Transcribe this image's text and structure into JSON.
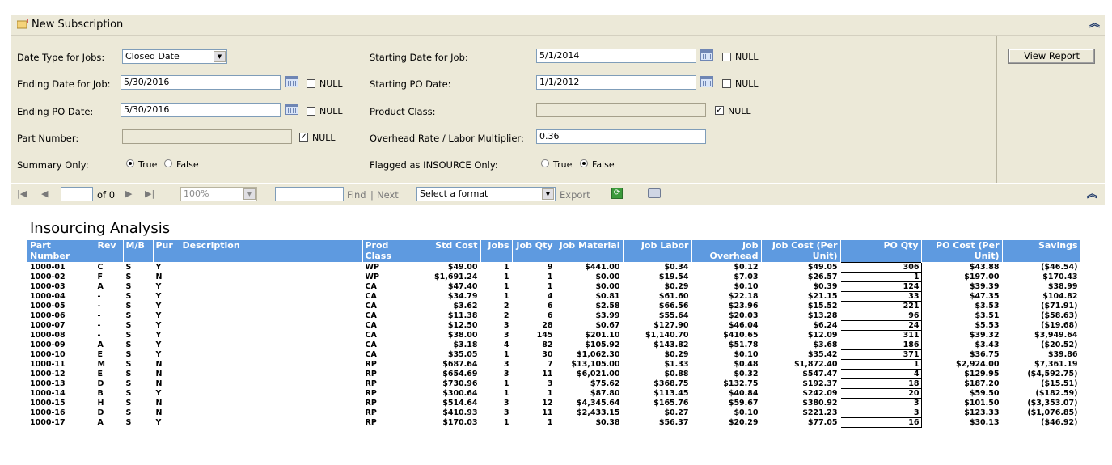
{
  "panel": {
    "title": "New Subscription"
  },
  "params": {
    "date_type_label": "Date Type for Jobs:",
    "date_type_value": "Closed Date",
    "starting_date_job_label": "Starting Date for Job:",
    "starting_date_job_value": "5/1/2014",
    "ending_date_job_label": "Ending Date for Job:",
    "ending_date_job_value": "5/30/2016",
    "starting_po_label": "Starting PO Date:",
    "starting_po_value": "1/1/2012",
    "ending_po_label": "Ending PO Date:",
    "ending_po_value": "5/30/2016",
    "product_class_label": "Product Class:",
    "product_class_value": "",
    "part_number_label": "Part Number:",
    "part_number_value": "",
    "overhead_label": "Overhead Rate / Labor Multiplier:",
    "overhead_value": "0.36",
    "summary_label": "Summary Only:",
    "insource_label": "Flagged as INSOURCE Only:",
    "null_label": "NULL",
    "true_label": "True",
    "false_label": "False",
    "view_report": "View Report"
  },
  "toolbar": {
    "page_value": "",
    "of_label": "of 0",
    "zoom": "100%",
    "find_value": "",
    "find_label": "Find",
    "sep": "|",
    "next_label": "Next",
    "format": "Select a format",
    "export_label": "Export"
  },
  "report": {
    "title": "Insourcing Analysis",
    "columns": [
      "Part Number",
      "Rev",
      "M/B",
      "Pur",
      "Description",
      "Prod Class",
      "Std Cost",
      "Jobs",
      "Job Qty",
      "Job Material",
      "Job Labor",
      "Job Overhead",
      "Job Cost (Per Unit)",
      "PO Qty",
      "PO Cost (Per Unit)",
      "Savings"
    ],
    "rows": [
      [
        "1000-01",
        "C",
        "S",
        "Y",
        "",
        "WP",
        "$49.00",
        "1",
        "9",
        "$441.00",
        "$0.34",
        "$0.12",
        "$49.05",
        "306",
        "$43.88",
        "($46.54)"
      ],
      [
        "1000-02",
        "F",
        "S",
        "N",
        "",
        "WP",
        "$1,691.24",
        "1",
        "1",
        "$0.00",
        "$19.54",
        "$7.03",
        "$26.57",
        "1",
        "$197.00",
        "$170.43"
      ],
      [
        "1000-03",
        "A",
        "S",
        "Y",
        "",
        "CA",
        "$47.40",
        "1",
        "1",
        "$0.00",
        "$0.29",
        "$0.10",
        "$0.39",
        "124",
        "$39.39",
        "$38.99"
      ],
      [
        "1000-04",
        "-",
        "S",
        "Y",
        "",
        "CA",
        "$34.79",
        "1",
        "4",
        "$0.81",
        "$61.60",
        "$22.18",
        "$21.15",
        "33",
        "$47.35",
        "$104.82"
      ],
      [
        "1000-05",
        "-",
        "S",
        "Y",
        "",
        "CA",
        "$3.62",
        "2",
        "6",
        "$2.58",
        "$66.56",
        "$23.96",
        "$15.52",
        "221",
        "$3.53",
        "($71.91)"
      ],
      [
        "1000-06",
        "-",
        "S",
        "Y",
        "",
        "CA",
        "$11.38",
        "2",
        "6",
        "$3.99",
        "$55.64",
        "$20.03",
        "$13.28",
        "96",
        "$3.51",
        "($58.63)"
      ],
      [
        "1000-07",
        "-",
        "S",
        "Y",
        "",
        "CA",
        "$12.50",
        "3",
        "28",
        "$0.67",
        "$127.90",
        "$46.04",
        "$6.24",
        "24",
        "$5.53",
        "($19.68)"
      ],
      [
        "1000-08",
        "-",
        "S",
        "Y",
        "",
        "CA",
        "$38.00",
        "3",
        "145",
        "$201.10",
        "$1,140.70",
        "$410.65",
        "$12.09",
        "311",
        "$39.32",
        "$3,949.64"
      ],
      [
        "1000-09",
        "A",
        "S",
        "Y",
        "",
        "CA",
        "$3.18",
        "4",
        "82",
        "$105.92",
        "$143.82",
        "$51.78",
        "$3.68",
        "186",
        "$3.43",
        "($20.52)"
      ],
      [
        "1000-10",
        "E",
        "S",
        "Y",
        "",
        "CA",
        "$35.05",
        "1",
        "30",
        "$1,062.30",
        "$0.29",
        "$0.10",
        "$35.42",
        "371",
        "$36.75",
        "$39.86"
      ],
      [
        "1000-11",
        "M",
        "S",
        "N",
        "",
        "RP",
        "$687.64",
        "3",
        "7",
        "$13,105.00",
        "$1.33",
        "$0.48",
        "$1,872.40",
        "1",
        "$2,924.00",
        "$7,361.19"
      ],
      [
        "1000-12",
        "E",
        "S",
        "N",
        "",
        "RP",
        "$654.69",
        "3",
        "11",
        "$6,021.00",
        "$0.88",
        "$0.32",
        "$547.47",
        "4",
        "$129.95",
        "($4,592.75)"
      ],
      [
        "1000-13",
        "D",
        "S",
        "N",
        "",
        "RP",
        "$730.96",
        "1",
        "3",
        "$75.62",
        "$368.75",
        "$132.75",
        "$192.37",
        "18",
        "$187.20",
        "($15.51)"
      ],
      [
        "1000-14",
        "B",
        "S",
        "Y",
        "",
        "RP",
        "$300.64",
        "1",
        "1",
        "$87.80",
        "$113.45",
        "$40.84",
        "$242.09",
        "20",
        "$59.50",
        "($182.59)"
      ],
      [
        "1000-15",
        "H",
        "S",
        "N",
        "",
        "RP",
        "$514.64",
        "3",
        "12",
        "$4,345.64",
        "$165.76",
        "$59.67",
        "$380.92",
        "3",
        "$101.50",
        "($3,353.07)"
      ],
      [
        "1000-16",
        "D",
        "S",
        "N",
        "",
        "RP",
        "$410.93",
        "3",
        "11",
        "$2,433.15",
        "$0.27",
        "$0.10",
        "$221.23",
        "3",
        "$123.33",
        "($1,076.85)"
      ],
      [
        "1000-17",
        "A",
        "S",
        "Y",
        "",
        "RP",
        "$170.03",
        "1",
        "1",
        "$0.38",
        "$56.37",
        "$20.29",
        "$77.05",
        "16",
        "$30.13",
        "($46.92)"
      ]
    ]
  }
}
